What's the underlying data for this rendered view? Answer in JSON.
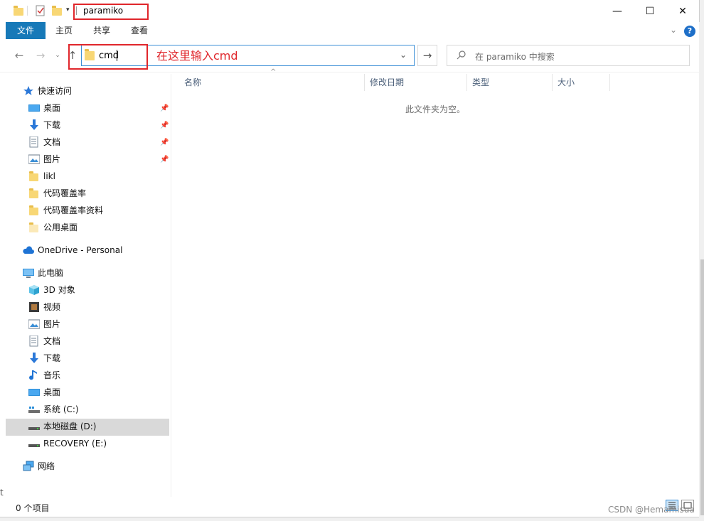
{
  "window": {
    "title": "paramiko",
    "controls": {
      "minimize": "—",
      "maximize": "☐",
      "close": "✕"
    }
  },
  "ribbon": {
    "tabs": [
      "文件",
      "主页",
      "共享",
      "查看"
    ],
    "expand_icon": "chevron-down-icon",
    "help_icon": "?"
  },
  "address": {
    "value": "cmd",
    "annotation": "在这里输入cmd",
    "go_icon": "→"
  },
  "search": {
    "placeholder": "在 paramiko 中搜索"
  },
  "nav": {
    "quick_access": "快速访问",
    "quick_items": [
      {
        "label": "桌面",
        "icon": "desktop-icon",
        "pinned": true
      },
      {
        "label": "下载",
        "icon": "download-icon",
        "pinned": true
      },
      {
        "label": "文档",
        "icon": "document-icon",
        "pinned": true
      },
      {
        "label": "图片",
        "icon": "pictures-icon",
        "pinned": true
      },
      {
        "label": "likl",
        "icon": "folder-icon",
        "pinned": false
      },
      {
        "label": "代码覆盖率",
        "icon": "folder-icon",
        "pinned": false
      },
      {
        "label": "代码覆盖率资料",
        "icon": "folder-icon",
        "pinned": false
      },
      {
        "label": "公用桌面",
        "icon": "folder-icon",
        "pinned": false
      }
    ],
    "onedrive": "OneDrive - Personal",
    "this_pc": "此电脑",
    "pc_items": [
      {
        "label": "3D 对象",
        "icon": "3d-objects-icon"
      },
      {
        "label": "视频",
        "icon": "video-icon"
      },
      {
        "label": "图片",
        "icon": "pictures-icon"
      },
      {
        "label": "文档",
        "icon": "document-icon"
      },
      {
        "label": "下载",
        "icon": "download-icon"
      },
      {
        "label": "音乐",
        "icon": "music-icon"
      },
      {
        "label": "桌面",
        "icon": "desktop-icon"
      },
      {
        "label": "系统 (C:)",
        "icon": "drive-icon"
      },
      {
        "label": "本地磁盘 (D:)",
        "icon": "drive-icon",
        "selected": true
      },
      {
        "label": "RECOVERY (E:)",
        "icon": "drive-icon"
      }
    ],
    "network": "网络"
  },
  "columns": [
    "名称",
    "修改日期",
    "类型",
    "大小"
  ],
  "empty_message": "此文件夹为空。",
  "status": {
    "item_count": "0 个项目"
  },
  "watermark": "CSDN @Hemamisua",
  "colors": {
    "file_tab": "#1779b8",
    "annotation": "#e0262b",
    "address_border": "#3c8fd6"
  }
}
